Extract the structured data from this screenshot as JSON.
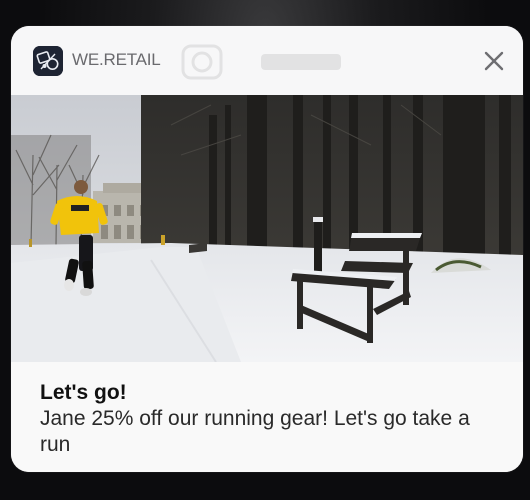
{
  "notification": {
    "app_name": "WE.RETAIL",
    "app_icon": "we-retail-logo-icon",
    "close_icon": "close-icon",
    "image": "snowy-park-runner-photo",
    "title": "Let's go!",
    "body": "Jane 25% off our running gear! Let's go take a run"
  },
  "colors": {
    "card_background": "#f9f9f9",
    "backdrop": "#0c0c0e",
    "app_name_text": "#6a6a6e",
    "title_text": "#111111",
    "body_text": "#2a2a2a",
    "close_icon": "#6e6e72"
  }
}
